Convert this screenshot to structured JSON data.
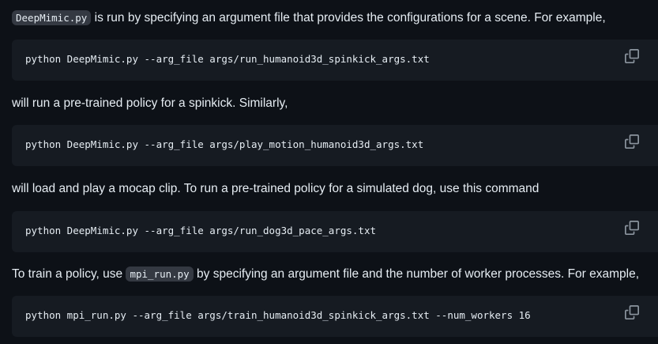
{
  "paragraphs": {
    "p1": {
      "code": "DeepMimic.py",
      "text": " is run by specifying an argument file that provides the configurations for a scene. For example,"
    },
    "p2": {
      "text": "will run a pre-trained policy for a spinkick. Similarly,"
    },
    "p3": {
      "text": "will load and play a mocap clip. To run a pre-trained policy for a simulated dog, use this command"
    },
    "p4": {
      "pre": "To train a policy, use ",
      "code": "mpi_run.py",
      "post": " by specifying an argument file and the number of worker processes. For example,"
    }
  },
  "code_blocks": [
    {
      "command": "python DeepMimic.py --arg_file args/run_humanoid3d_spinkick_args.txt"
    },
    {
      "command": "python DeepMimic.py --arg_file args/play_motion_humanoid3d_args.txt"
    },
    {
      "command": "python DeepMimic.py --arg_file args/run_dog3d_pace_args.txt"
    },
    {
      "command": "python mpi_run.py --arg_file args/train_humanoid3d_spinkick_args.txt --num_workers 16"
    }
  ],
  "icons": {
    "copy": "copy-icon"
  },
  "colors": {
    "background": "#0d1117",
    "code_background": "#161b22",
    "inline_code_background": "#343942",
    "text": "#e6edf3",
    "icon": "#8b949e"
  }
}
